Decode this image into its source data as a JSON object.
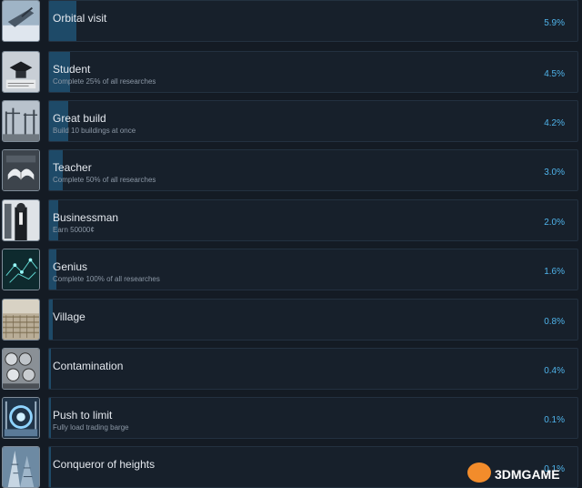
{
  "achievements": [
    {
      "title": "Orbital visit",
      "description": "",
      "percent": "5.9%",
      "progress": 5.9,
      "image_icon": "spaceship-image-icon"
    },
    {
      "title": "Student",
      "description": "Complete 25% of all researches",
      "percent": "4.5%",
      "progress": 4.5,
      "image_icon": "graduation-cap-image-icon"
    },
    {
      "title": "Great build",
      "description": "Build 10 buildings at once",
      "percent": "4.2%",
      "progress": 4.2,
      "image_icon": "construction-site-image-icon"
    },
    {
      "title": "Teacher",
      "description": "Complete 50% of all researches",
      "percent": "3.0%",
      "progress": 3.0,
      "image_icon": "open-book-image-icon"
    },
    {
      "title": "Businessman",
      "description": "Earn 50000¢",
      "percent": "2.0%",
      "progress": 2.0,
      "image_icon": "businessman-image-icon"
    },
    {
      "title": "Genius",
      "description": "Complete 100% of all researches",
      "percent": "1.6%",
      "progress": 1.6,
      "image_icon": "brain-network-image-icon"
    },
    {
      "title": "Village",
      "description": "",
      "percent": "0.8%",
      "progress": 0.8,
      "image_icon": "village-field-image-icon"
    },
    {
      "title": "Contamination",
      "description": "",
      "percent": "0.4%",
      "progress": 0.4,
      "image_icon": "barrels-image-icon"
    },
    {
      "title": "Push to limit",
      "description": "Fully load trading barge",
      "percent": "0.1%",
      "progress": 0.1,
      "image_icon": "reactor-image-icon"
    },
    {
      "title": "Conqueror of heights",
      "description": "",
      "percent": "0.1%",
      "progress": 0.1,
      "image_icon": "skyscraper-image-icon"
    }
  ],
  "watermark": {
    "text": "3DMGAME"
  },
  "colors": {
    "progress_fill": "#1e4a68",
    "percent_text": "#4fb3ea",
    "card_bg": "#17202b",
    "page_bg": "#141b24"
  }
}
